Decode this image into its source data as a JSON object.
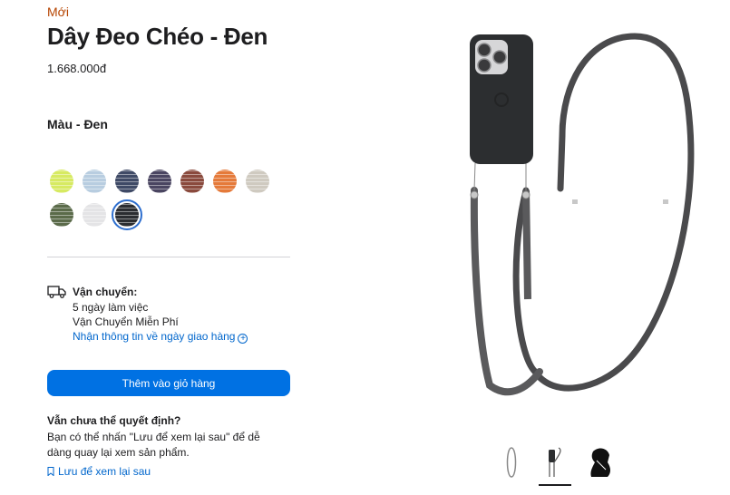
{
  "product": {
    "badge": "Mới",
    "title": "Dây Đeo Chéo - Đen",
    "price": "1.668.000đ",
    "color_label": "Màu - Đen"
  },
  "swatches": [
    {
      "name": "yellow-green",
      "color": "#d7ea62"
    },
    {
      "name": "light-blue",
      "color": "#b8cde0"
    },
    {
      "name": "navy",
      "color": "#3f4a66"
    },
    {
      "name": "dark-purple",
      "color": "#4a4561"
    },
    {
      "name": "brown-red",
      "color": "#8a4a3d"
    },
    {
      "name": "orange",
      "color": "#e57a3a"
    },
    {
      "name": "beige",
      "color": "#cfcac0"
    },
    {
      "name": "olive",
      "color": "#5b6b4a"
    },
    {
      "name": "white",
      "color": "#e4e4e6"
    },
    {
      "name": "black",
      "color": "#2b2d31",
      "selected": true
    }
  ],
  "shipping": {
    "icon": "truck-icon",
    "title": "Vận chuyển:",
    "line1": "5 ngày làm việc",
    "line2": "Vận Chuyển Miễn Phí",
    "link": "Nhận thông tin về ngày giao hàng"
  },
  "cart": {
    "button": "Thêm vào giỏ hàng"
  },
  "undecided": {
    "title": "Vẫn chưa thể quyết định?",
    "text": "Bạn có thể nhấn \"Lưu để xem lại sau\" để dễ dàng quay lại xem sản phẩm.",
    "save_link": "Lưu để xem lại sau"
  },
  "thumbnails": [
    "strap-only-thumbnail",
    "phone-with-strap-thumbnail",
    "person-wearing-thumbnail"
  ]
}
